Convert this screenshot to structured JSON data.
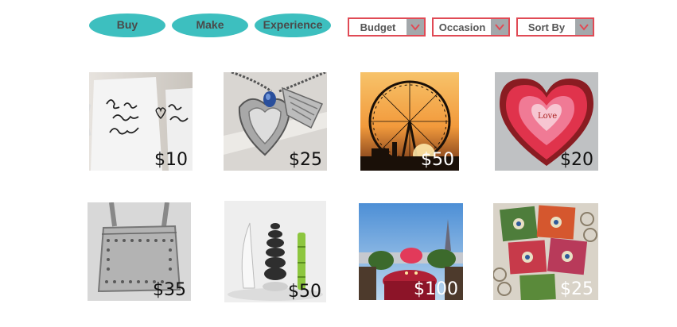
{
  "nav": {
    "pills": [
      {
        "label": "Buy"
      },
      {
        "label": "Make"
      },
      {
        "label": "Experience"
      }
    ],
    "filters": [
      {
        "label": "Budget",
        "icon": "chevron-down-icon"
      },
      {
        "label": "Occasion",
        "icon": "chevron-down-icon"
      },
      {
        "label": "Sort By",
        "icon": "chevron-down-icon"
      }
    ]
  },
  "products": [
    {
      "price": "$10",
      "image": "good-morning-mugs"
    },
    {
      "price": "$25",
      "image": "heart-locket-necklace"
    },
    {
      "price": "$50",
      "image": "london-eye-sunset"
    },
    {
      "price": "$20",
      "image": "heart-rose-box"
    },
    {
      "price": "$35",
      "image": "studded-silver-bag"
    },
    {
      "price": "$50",
      "image": "stone-sculptures"
    },
    {
      "price": "$100",
      "image": "paris-dinner"
    },
    {
      "price": "$25",
      "image": "felt-coasters"
    }
  ],
  "colors": {
    "accent": "#3dbfbf",
    "filter_border": "#e04a55",
    "filter_button": "#a3a8ab"
  }
}
